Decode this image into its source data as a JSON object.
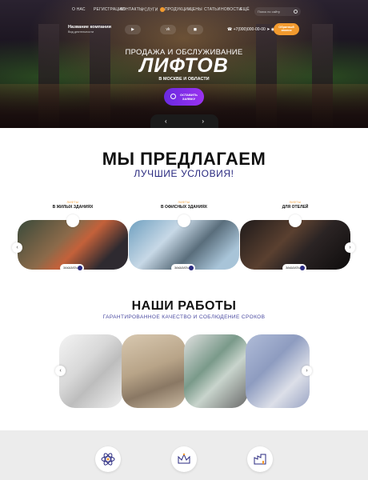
{
  "nav": {
    "items": [
      "О НАС",
      "РЕГИСТРАЦИИ",
      "КОНТАКТЫ",
      "УСЛУГИ",
      "ПРОДУКЦИИ",
      "ЦЕНЫ",
      "СТАТЬИ",
      "НОВОСТИ",
      "ЕЩЁ"
    ],
    "search_placeholder": "Поиск по сайту"
  },
  "header": {
    "company_name": "Название компании",
    "company_sub": "Вид деятельности",
    "phone": "+7(000)000-00-00",
    "cta": "Обратный звонок"
  },
  "hero": {
    "subtitle": "ПРОДАЖА И ОБСЛУЖИВАНИЕ",
    "title": "ЛИФТОВ",
    "location": "В МОСКВЕ И ОБЛАСТИ",
    "order_button": "ОСТАВИТЬ ЗАЯВКУ",
    "prev": "‹",
    "next": "›"
  },
  "offers": {
    "title": "МЫ ПРЕДЛАГАЕМ",
    "subtitle": "ЛУЧШИЕ УСЛОВИЯ!",
    "small_label": "ЛИФТЫ",
    "cards": [
      {
        "label": "В ЖИЛЫХ ЗДАНИЯХ",
        "button": "ЗАКАЗАТЬ"
      },
      {
        "label": "В ОФИСНЫХ ЗДАНИЯХ",
        "button": "ЗАКАЗАТЬ"
      },
      {
        "label": "ДЛЯ ОТЕЛЕЙ",
        "button": "ЗАКАЗАТЬ"
      }
    ]
  },
  "works": {
    "title": "НАШИ РАБОТЫ",
    "subtitle": "ГАРАНТИРОВАННОЕ КАЧЕСТВО И СОБЛЮДЕНИЕ СРОКОВ"
  },
  "colors": {
    "accent": "#f29a2e",
    "primary": "#6a2ae0",
    "dark": "#111111"
  }
}
